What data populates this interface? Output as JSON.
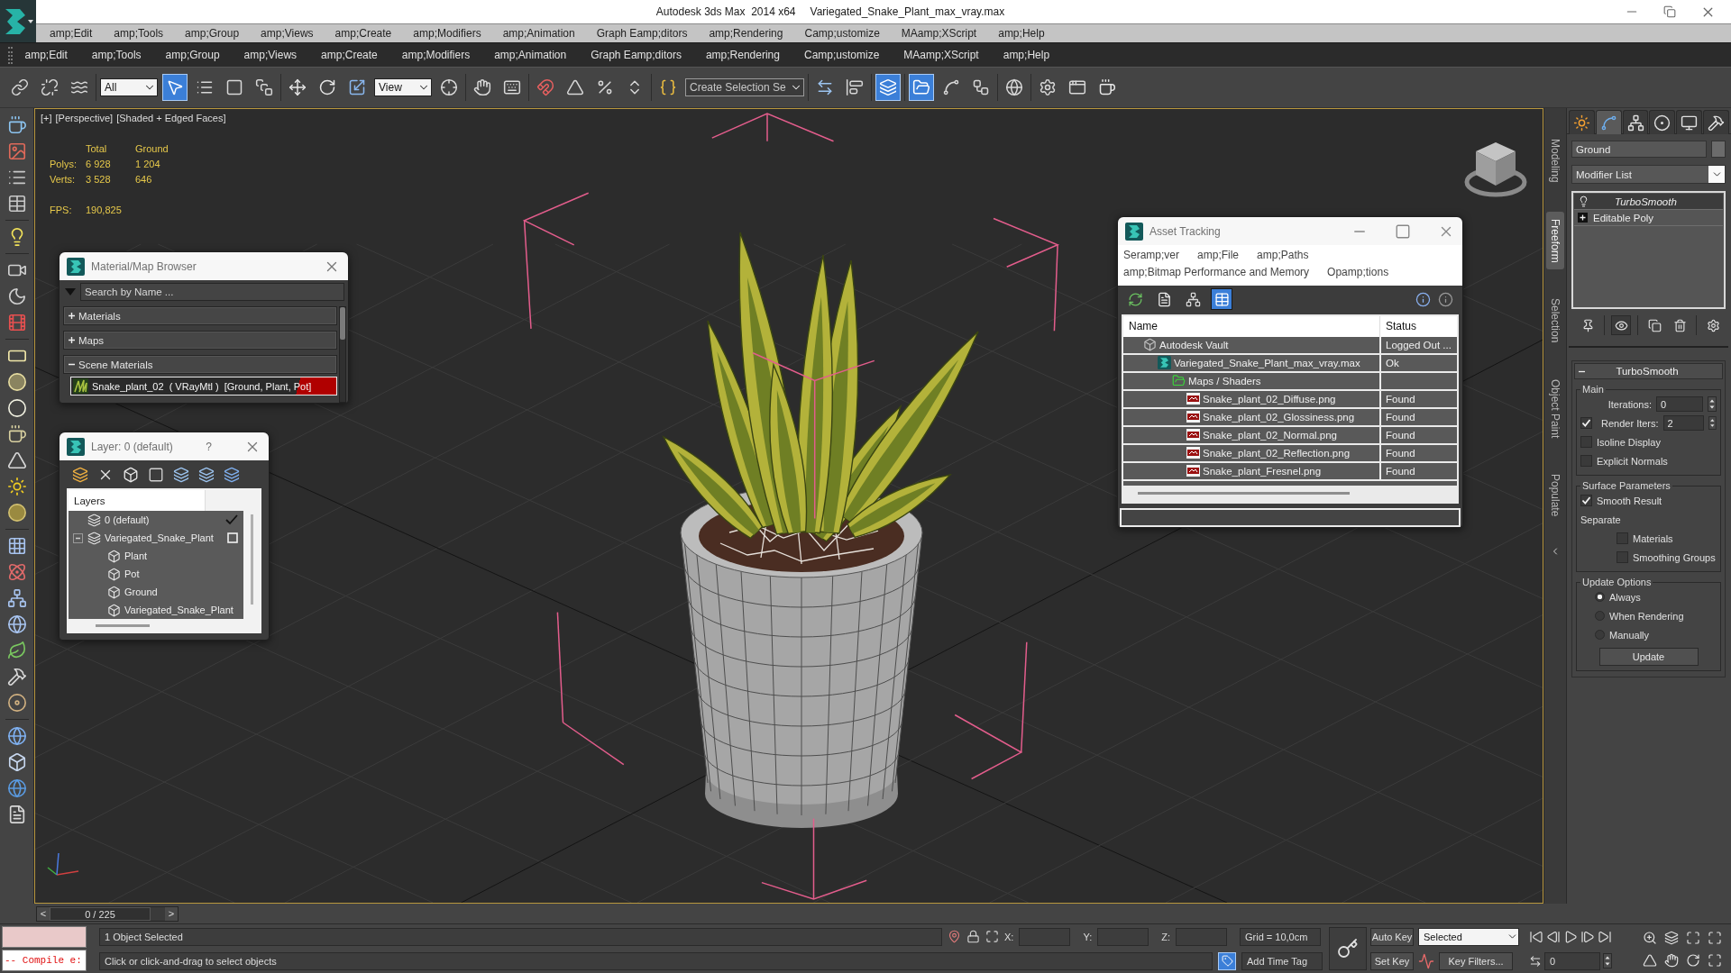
{
  "title_bar": {
    "app_name": "Autodesk 3ds Max  2014 x64",
    "file_name": "Variegated_Snake_Plant_max_vray.max"
  },
  "menu_bars": [
    {
      "items": [
        "amp;Edit",
        "amp;Tools",
        "amp;Group",
        "amp;Views",
        "amp;Create",
        "amp;Modifiers",
        "amp;Animation",
        "Graph Eamp;ditors",
        "amp;Rendering",
        "Camp;ustomize",
        "MAamp;XScript",
        "amp;Help"
      ]
    },
    {
      "items": [
        "amp;Edit",
        "amp;Tools",
        "amp;Group",
        "amp;Views",
        "amp;Create",
        "amp;Modifiers",
        "amp;Animation",
        "Graph Eamp;ditors",
        "amp;Rendering",
        "Camp;ustomize",
        "MAamp;XScript",
        "amp;Help"
      ]
    }
  ],
  "main_toolbar": {
    "groups": [
      [
        {
          "kind": "link",
          "selected": false
        },
        {
          "kind": "unlink",
          "selected": false
        },
        {
          "kind": "bind",
          "selected": false
        }
      ],
      [
        {
          "kind": "dropdown",
          "value": "All"
        },
        {
          "kind": "select",
          "selected": true
        },
        {
          "kind": "select_by_name",
          "selected": false
        },
        {
          "kind": "region",
          "selected": false
        },
        {
          "kind": "crossing",
          "selected": false
        }
      ],
      [
        {
          "kind": "move",
          "selected": false
        },
        {
          "kind": "rotate",
          "selected": false
        },
        {
          "kind": "scale",
          "selected": false
        },
        {
          "kind": "dropdown",
          "value": "View"
        },
        {
          "kind": "pivot",
          "selected": false
        }
      ],
      [
        {
          "kind": "manipulate",
          "selected": false
        },
        {
          "kind": "keyboard",
          "selected": false
        }
      ],
      [
        {
          "kind": "snap",
          "selected": false
        },
        {
          "kind": "angle_snap",
          "selected": false
        },
        {
          "kind": "percent_snap",
          "selected": false
        },
        {
          "kind": "spinner_snap",
          "selected": false
        }
      ],
      [
        {
          "kind": "edit_named",
          "selected": false
        },
        {
          "kind": "combo",
          "value": "Create Selection Se"
        }
      ],
      [
        {
          "kind": "mirror",
          "selected": false
        },
        {
          "kind": "align",
          "selected": false
        }
      ],
      [
        {
          "kind": "scene_explorer",
          "selected": true
        }
      ],
      [
        {
          "kind": "layer_explorer",
          "selected": true
        },
        {
          "kind": "curve_editor",
          "selected": false
        },
        {
          "kind": "schematic",
          "selected": false
        }
      ],
      [
        {
          "kind": "material_editor",
          "selected": false
        }
      ],
      [
        {
          "kind": "render_setup",
          "selected": false
        },
        {
          "kind": "rendered_frame",
          "selected": false
        },
        {
          "kind": "render",
          "selected": false
        }
      ]
    ]
  },
  "viewport": {
    "menus": [
      "[+]",
      "[Perspective]",
      "[Shaded + Edged Faces]"
    ],
    "stats": {
      "columns": [
        "Total",
        "Ground"
      ],
      "rows": [
        {
          "label": "Polys:",
          "values": [
            "6 928",
            "1 204"
          ]
        },
        {
          "label": "Verts:",
          "values": [
            "3 528",
            "646"
          ]
        }
      ],
      "fps_label": "FPS:",
      "fps": "190,825"
    }
  },
  "material_browser": {
    "title": "Material/Map Browser",
    "search_placeholder": "Search by Name ...",
    "groups": [
      {
        "label": "Materials",
        "expanded": false
      },
      {
        "label": "Maps",
        "expanded": false
      },
      {
        "label": "Scene Materials",
        "expanded": true,
        "items": [
          {
            "name": "Snake_plant_02  ( VRayMtl )  [Ground, Plant, Pot]"
          }
        ]
      }
    ]
  },
  "layer_explorer": {
    "title": "Layer: 0 (default)",
    "help": "?",
    "header": "Layers",
    "tree": [
      {
        "name": "0 (default)",
        "kind": "layer",
        "current": true
      },
      {
        "name": "Variegated_Snake_Plant",
        "kind": "layer",
        "current": false,
        "expanded": true,
        "children": [
          {
            "name": "Plant",
            "kind": "object"
          },
          {
            "name": "Pot",
            "kind": "object"
          },
          {
            "name": "Ground",
            "kind": "object"
          },
          {
            "name": "Variegated_Snake_Plant",
            "kind": "object"
          }
        ]
      }
    ]
  },
  "asset_tracking": {
    "title": "Asset Tracking",
    "menu": [
      "Seramp;ver",
      "amp;File",
      "amp;Paths",
      "amp;Bitmap Performance and Memory",
      "Opamp;tions"
    ],
    "view_modes": [
      {
        "kind": "refresh",
        "selected": false
      },
      {
        "kind": "list",
        "selected": false
      },
      {
        "kind": "tree",
        "selected": false
      },
      {
        "kind": "table",
        "selected": true
      }
    ],
    "columns": [
      "Name",
      "Status"
    ],
    "rows": [
      {
        "name": "Autodesk Vault",
        "kind": "vault",
        "status": "Logged Out ...",
        "children": [
          {
            "name": "Variegated_Snake_Plant_max_vray.max",
            "kind": "scene",
            "status": "Ok",
            "children": [
              {
                "name": "Maps / Shaders",
                "kind": "folder",
                "children": [
                  {
                    "name": "Snake_plant_02_Diffuse.png",
                    "kind": "image",
                    "status": "Found"
                  },
                  {
                    "name": "Snake_plant_02_Glossiness.png",
                    "kind": "image",
                    "status": "Found"
                  },
                  {
                    "name": "Snake_plant_02_Normal.png",
                    "kind": "image",
                    "status": "Found"
                  },
                  {
                    "name": "Snake_plant_02_Reflection.png",
                    "kind": "image",
                    "status": "Found"
                  },
                  {
                    "name": "Snake_plant_Fresnel.png",
                    "kind": "image",
                    "status": "Found"
                  }
                ]
              }
            ]
          }
        ]
      }
    ]
  },
  "ribbon_tabs": [
    {
      "label": "Modeling",
      "selected": false
    },
    {
      "label": "Freeform",
      "selected": true
    },
    {
      "label": "Selection",
      "selected": false
    },
    {
      "label": "Object Paint",
      "selected": false
    },
    {
      "label": "Populate",
      "selected": false
    }
  ],
  "command_panel": {
    "tabs": [
      {
        "kind": "create",
        "selected": false
      },
      {
        "kind": "modify",
        "selected": true
      },
      {
        "kind": "hierarchy",
        "selected": false
      },
      {
        "kind": "motion",
        "selected": false
      },
      {
        "kind": "display",
        "selected": false
      },
      {
        "kind": "utilities",
        "selected": false
      }
    ],
    "object_name": "Ground",
    "modifier_list": "Modifier List",
    "stack": [
      {
        "name": "TurboSmooth",
        "kind": "modifier",
        "selected": true
      },
      {
        "name": "Editable Poly",
        "kind": "base",
        "selected": false
      }
    ],
    "stack_tools": [
      [
        {
          "kind": "pin",
          "selected": false
        }
      ],
      [
        {
          "kind": "end_result",
          "selected": true
        }
      ],
      [
        {
          "kind": "unique",
          "selected": false
        },
        {
          "kind": "remove",
          "selected": false
        }
      ],
      [
        {
          "kind": "configure",
          "selected": false
        }
      ]
    ],
    "rollout": {
      "title": "TurboSmooth",
      "expanded": true,
      "groups": [
        {
          "title": "Main",
          "controls": [
            {
              "kind": "spinner",
              "label": "Iterations:",
              "value": "0"
            },
            {
              "kind": "check_spinner",
              "label": "Render Iters:",
              "checked": true,
              "value": "2"
            },
            {
              "kind": "checkbox",
              "label": "Isoline Display",
              "checked": false
            },
            {
              "kind": "checkbox",
              "label": "Explicit Normals",
              "checked": false
            }
          ]
        },
        {
          "title": "Surface Parameters",
          "controls": [
            {
              "kind": "checkbox",
              "label": "Smooth Result",
              "checked": true
            },
            {
              "kind": "label",
              "label": "Separate",
              "children": [
                {
                  "kind": "checkbox",
                  "label": "Materials",
                  "checked": false
                },
                {
                  "kind": "checkbox",
                  "label": "Smoothing Groups",
                  "checked": false
                }
              ]
            }
          ]
        },
        {
          "title": "Update Options",
          "controls": [
            {
              "kind": "radio",
              "label": "Always",
              "selected": true
            },
            {
              "kind": "radio",
              "label": "When Rendering",
              "selected": false
            },
            {
              "kind": "radio",
              "label": "Manually",
              "selected": false
            },
            {
              "kind": "button",
              "label": "Update"
            }
          ]
        }
      ]
    }
  },
  "time_slider": {
    "previous": "<",
    "position": "0 / 225",
    "level": 0,
    "next": ">"
  },
  "status_bar": {
    "listener_output": "-- Compile e:",
    "selection": "1 Object Selected",
    "prompt": "Click or click-and-drag to select objects",
    "coordinates": [
      "X:",
      "Y:",
      "Z:"
    ],
    "grid": "Grid = 10,0cm",
    "time_tag": "Add Time Tag",
    "auto_key": "Auto Key",
    "key_mode": "Selected",
    "set_key": "Set Key",
    "key_filters": "Key Filters...",
    "frame": "0"
  }
}
